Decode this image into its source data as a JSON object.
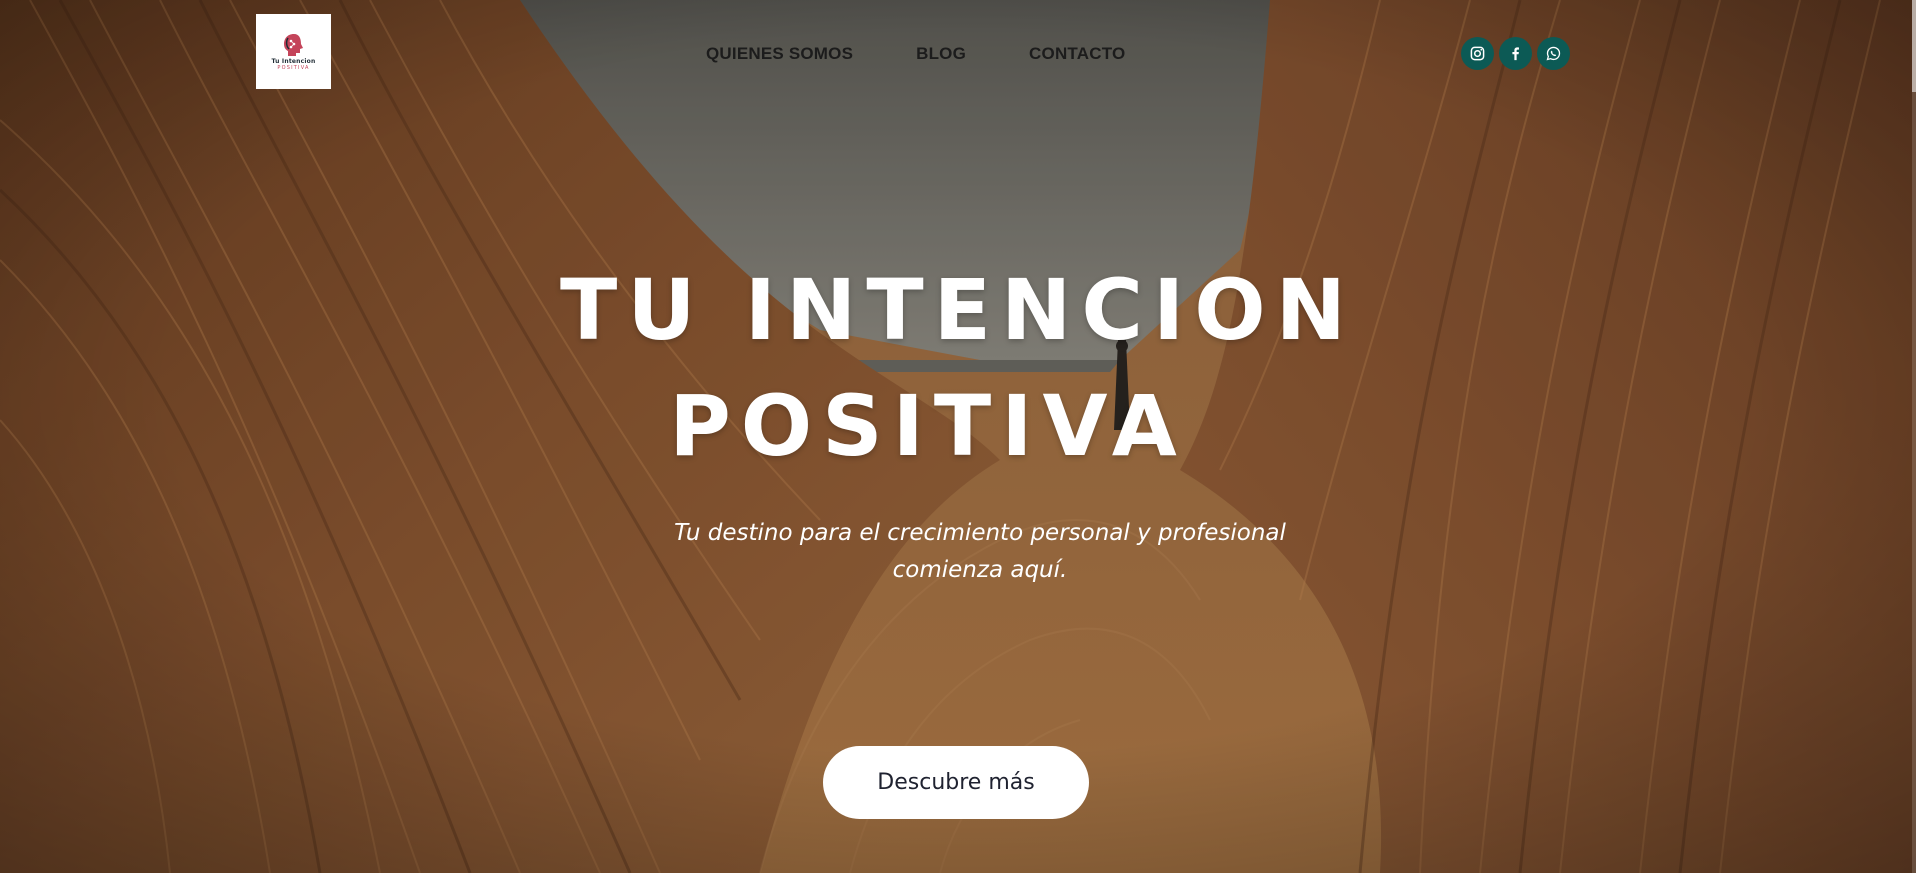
{
  "logo": {
    "line1": "Tu Intencion",
    "line2": "POSITIVA"
  },
  "nav": {
    "items": [
      {
        "label": "QUIENES SOMOS"
      },
      {
        "label": "BLOG"
      },
      {
        "label": "CONTACTO"
      }
    ]
  },
  "social": {
    "color": "#0c5a55",
    "icons": [
      "instagram-icon",
      "facebook-icon",
      "whatsapp-icon"
    ]
  },
  "hero": {
    "title_line1": "TU INTENCION",
    "title_line2": "POSITIVA",
    "subtitle": "Tu destino para el crecimiento personal y profesional comienza aquí.",
    "cta_label": "Descubre más"
  }
}
